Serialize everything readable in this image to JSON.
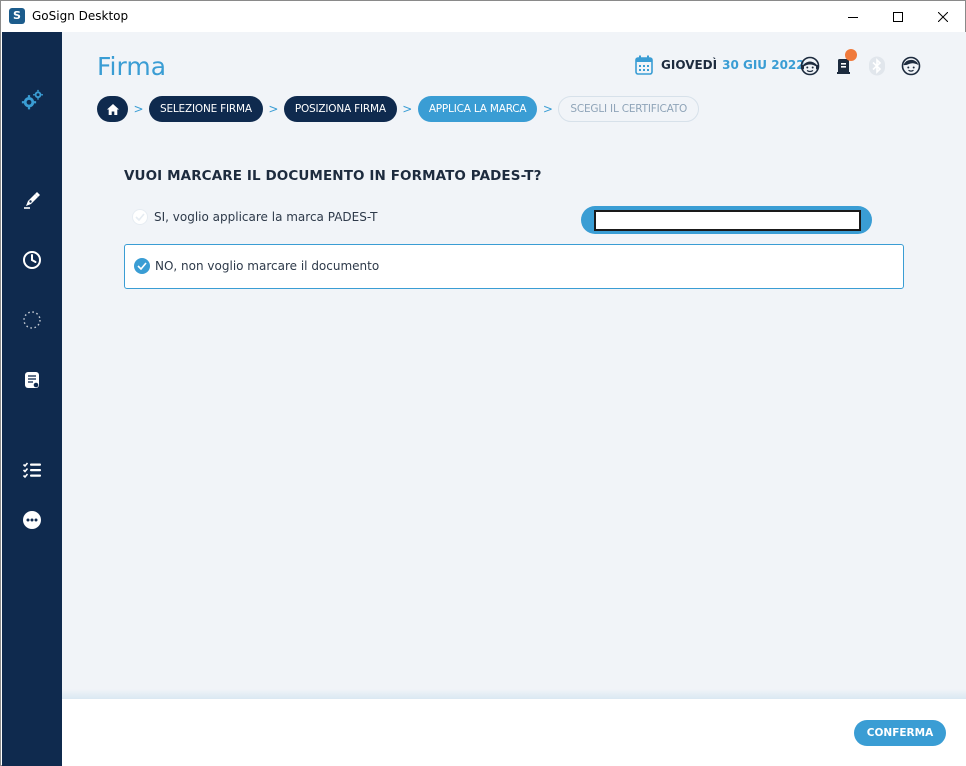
{
  "window": {
    "title": "GoSign Desktop",
    "app_icon_glyph": "S"
  },
  "header": {
    "page_title": "Firma",
    "date_day": "GIOVEDÌ",
    "date_value": "30 GIU 2022",
    "icons": [
      "calendar-icon",
      "support-icon",
      "notifications-icon",
      "bluetooth-icon",
      "user-avatar-icon"
    ]
  },
  "breadcrumb": {
    "steps": [
      {
        "label": "SELEZIONE FIRMA",
        "state": "done"
      },
      {
        "label": "POSIZIONA FIRMA",
        "state": "done"
      },
      {
        "label": "APPLICA LA MARCA",
        "state": "active"
      },
      {
        "label": "SCEGLI IL CERTIFICATO",
        "state": "todo"
      }
    ],
    "separator": ">"
  },
  "sidebar": {
    "items": [
      "settings-gears-icon",
      "sign-pen-icon",
      "history-clock-icon",
      "loading-dots-icon",
      "document-icon",
      "task-list-icon",
      "more-options-icon"
    ]
  },
  "form": {
    "question": "VUOI MARCARE IL DOCUMENTO IN FORMATO PADES-T?",
    "option_yes": "SI, voglio applicare la marca PADES-T",
    "option_no": "NO, non voglio marcare il documento",
    "selected": "no",
    "tsa_input_value": ""
  },
  "footer": {
    "confirm_label": "CONFERMA"
  },
  "colors": {
    "sidebar": "#0f2a4e",
    "accent": "#3a9dd4",
    "background": "#f1f4f8",
    "notification": "#f07a3c"
  }
}
